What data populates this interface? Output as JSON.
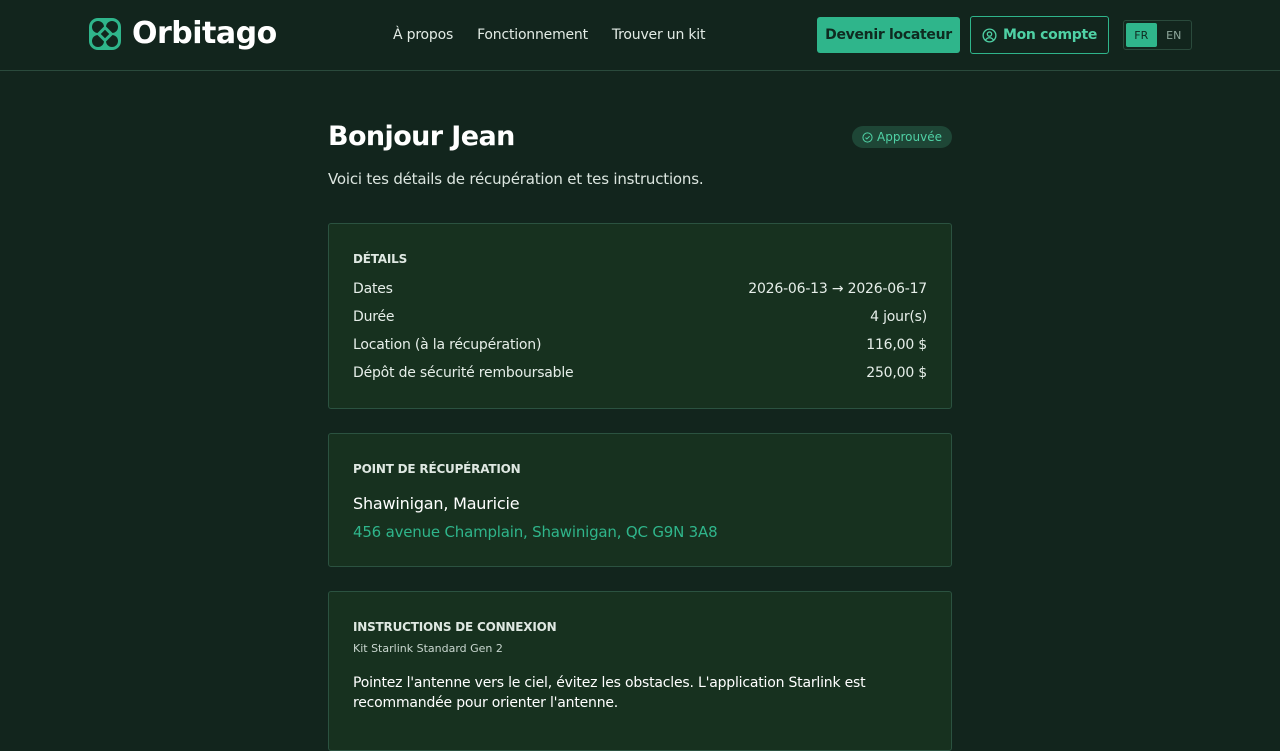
{
  "brand": {
    "name": "Orbitago",
    "accent": "#2fb58b",
    "background": "#12251d"
  },
  "nav": {
    "items": [
      {
        "label": "À propos"
      },
      {
        "label": "Fonctionnement"
      },
      {
        "label": "Trouver un kit"
      }
    ],
    "host_button": "Devenir locateur",
    "account_button": "Mon compte",
    "account_icon": "user-circle-icon",
    "languages": [
      {
        "code": "FR",
        "active": true
      },
      {
        "code": "EN",
        "active": false
      }
    ]
  },
  "page": {
    "title": "Bonjour Jean",
    "status_badge": "Approuvée",
    "status_icon": "check-circle-icon",
    "subtitle": "Voici tes détails de récupération et tes instructions."
  },
  "details": {
    "title": "DÉTAILS",
    "rows": [
      {
        "label": "Dates",
        "value": "2026-06-13 → 2026-06-17"
      },
      {
        "label": "Durée",
        "value": "4 jour(s)"
      },
      {
        "label": "Location (à la récupération)",
        "value": "116,00 $"
      },
      {
        "label": "Dépôt de sécurité remboursable",
        "value": "250,00 $"
      }
    ]
  },
  "pickup": {
    "title": "POINT DE RÉCUPÉRATION",
    "city": "Shawinigan, Mauricie",
    "address": "456 avenue Champlain, Shawinigan, QC G9N 3A8"
  },
  "instructions": {
    "title": "INSTRUCTIONS DE CONNEXION",
    "kit": "Kit Starlink Standard Gen 2",
    "text": "Pointez l'antenne vers le ciel, évitez les obstacles. L'application Starlink est recommandée pour orienter l'antenne."
  }
}
